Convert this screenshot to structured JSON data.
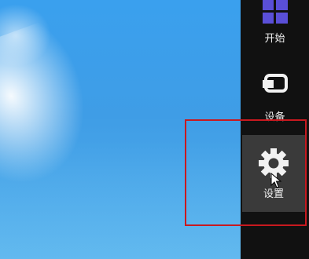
{
  "charms": {
    "start_label": "开始",
    "devices_label": "设备",
    "settings_label": "设置"
  },
  "colors": {
    "charm_bar_bg": "#111111",
    "selected_bg": "#3a3a3a",
    "highlight_border": "#c8191f",
    "start_icon": "#5a4fd8",
    "desktop_blue": "#3f9de6"
  },
  "icons": [
    "windows-start-icon",
    "devices-icon",
    "gear-icon",
    "mouse-cursor-icon"
  ]
}
